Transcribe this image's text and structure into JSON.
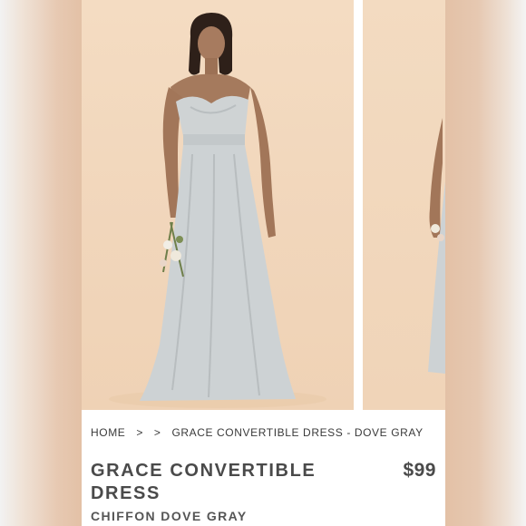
{
  "breadcrumb": {
    "home": "HOME",
    "separator1": ">",
    "separator2": ">",
    "current": "GRACE CONVERTIBLE DRESS - DOVE GRAY"
  },
  "product": {
    "title": "GRACE CONVERTIBLE DRESS",
    "price": "$99",
    "variant": "CHIFFON DOVE GRAY"
  },
  "colors": {
    "dress": "#c9ced0",
    "backdrop": "#f2d8bd",
    "text": "#4a4a4a"
  }
}
